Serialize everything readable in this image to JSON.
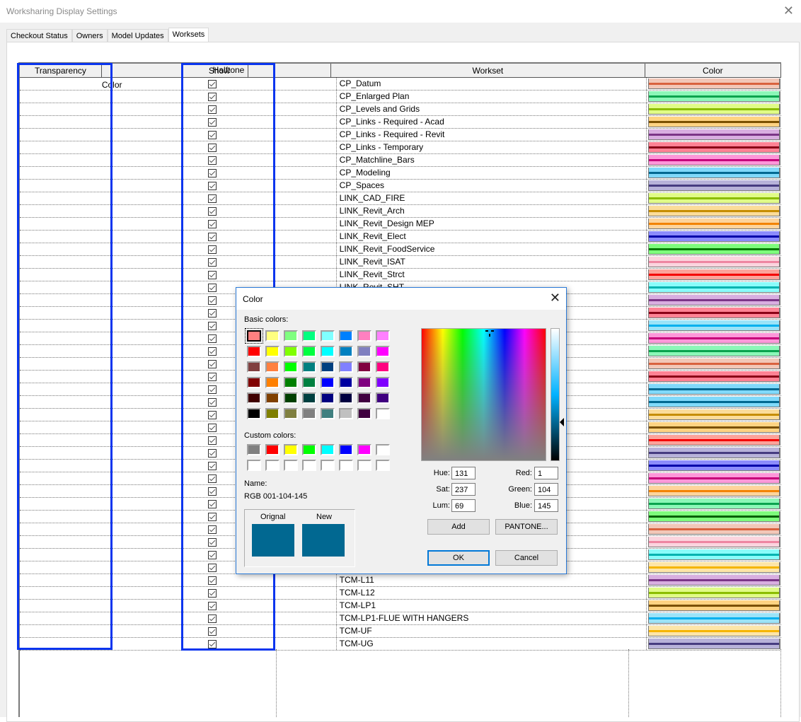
{
  "window": {
    "title": "Worksharing Display Settings",
    "close_glyph": "✕"
  },
  "tabs": [
    {
      "label": "Checkout Status",
      "active": false
    },
    {
      "label": "Owners",
      "active": false
    },
    {
      "label": "Model Updates",
      "active": false
    },
    {
      "label": "Worksets",
      "active": true
    }
  ],
  "table": {
    "headers": {
      "transparency": "Transparency",
      "show_color": "Show Color",
      "halftone": "Halftone",
      "workset": "Workset",
      "color": "Color"
    },
    "rows": [
      {
        "workset": "CP_Datum",
        "show_color": true,
        "fill": "#f2c7b8",
        "line": "#d9623f"
      },
      {
        "workset": "CP_Enlarged Plan",
        "show_color": true,
        "fill": "#8cf7b8",
        "line": "#0aa34e"
      },
      {
        "workset": "CP_Levels and Grids",
        "show_color": true,
        "fill": "#e0fb87",
        "line": "#8bbd00"
      },
      {
        "workset": "CP_Links - Required - Acad",
        "show_color": true,
        "fill": "#fed382",
        "line": "#7a5000"
      },
      {
        "workset": "CP_Links - Required - Revit",
        "show_color": true,
        "fill": "#d8aee0",
        "line": "#7b3587"
      },
      {
        "workset": "CP_Links - Temporary",
        "show_color": true,
        "fill": "#fe8294",
        "line": "#8a0016"
      },
      {
        "workset": "CP_Matchline_Bars",
        "show_color": true,
        "fill": "#fc97d9",
        "line": "#c6007b"
      },
      {
        "workset": "CP_Modeling",
        "show_color": true,
        "fill": "#80d9fa",
        "line": "#006891"
      },
      {
        "workset": "CP_Spaces",
        "show_color": true,
        "fill": "#b7b2d9",
        "line": "#463c80"
      },
      {
        "workset": "LINK_CAD_FIRE",
        "show_color": true,
        "fill": "#e0fb87",
        "line": "#8bbd00"
      },
      {
        "workset": "LINK_Revit_Arch",
        "show_color": true,
        "fill": "#fbdc9a",
        "line": "#c68d00"
      },
      {
        "workset": "LINK_Revit_Design MEP",
        "show_color": true,
        "fill": "#fdd49c",
        "line": "#f28300"
      },
      {
        "workset": "LINK_Revit_Elect",
        "show_color": true,
        "fill": "#8c8cfc",
        "line": "#0000aa"
      },
      {
        "workset": "LINK_Revit_FoodService",
        "show_color": true,
        "fill": "#7efc7c",
        "line": "#007a00"
      },
      {
        "workset": "LINK_Revit_ISAT",
        "show_color": true,
        "fill": "#fbd4de",
        "line": "#ee86a2"
      },
      {
        "workset": "LINK_Revit_Strct",
        "show_color": true,
        "fill": "#fca29a",
        "line": "#f40000"
      },
      {
        "workset": "LINK_Revit_SHT",
        "show_color": true,
        "fill": "#8afcfa",
        "line": "#00b3b0"
      },
      {
        "workset": "",
        "show_color": true,
        "fill": "#d8aee0",
        "line": "#7b3587"
      },
      {
        "workset": "",
        "show_color": true,
        "fill": "#fe8294",
        "line": "#8a0016"
      },
      {
        "workset": "",
        "show_color": true,
        "fill": "#9be3f8",
        "line": "#00b0ee"
      },
      {
        "workset": "",
        "show_color": true,
        "fill": "#fc97d9",
        "line": "#c6007b"
      },
      {
        "workset": "",
        "show_color": true,
        "fill": "#8cf7b8",
        "line": "#0aa34e"
      },
      {
        "workset": "",
        "show_color": true,
        "fill": "#f2c7b8",
        "line": "#d9623f"
      },
      {
        "workset": "",
        "show_color": true,
        "fill": "#fe8294",
        "line": "#8a0016"
      },
      {
        "workset": "",
        "show_color": true,
        "fill": "#80d9fa",
        "line": "#006891"
      },
      {
        "workset": "",
        "show_color": true,
        "fill": "#80d9fa",
        "line": "#006891"
      },
      {
        "workset": "",
        "show_color": true,
        "fill": "#fbdc9a",
        "line": "#c68d00"
      },
      {
        "workset": "",
        "show_color": true,
        "fill": "#fed382",
        "line": "#7a5000"
      },
      {
        "workset": "",
        "show_color": true,
        "fill": "#fca29a",
        "line": "#f40000"
      },
      {
        "workset": "",
        "show_color": true,
        "fill": "#b7b2d9",
        "line": "#463c80"
      },
      {
        "workset": "",
        "show_color": true,
        "fill": "#8c8cfc",
        "line": "#0000aa"
      },
      {
        "workset": "",
        "show_color": true,
        "fill": "#fc97d9",
        "line": "#c6007b"
      },
      {
        "workset": "",
        "show_color": true,
        "fill": "#fdd49c",
        "line": "#f28300"
      },
      {
        "workset": "",
        "show_color": true,
        "fill": "#8cf7b8",
        "line": "#0aa34e"
      },
      {
        "workset": "",
        "show_color": true,
        "fill": "#7efc7c",
        "line": "#006000"
      },
      {
        "workset": "",
        "show_color": true,
        "fill": "#f2c7b8",
        "line": "#d9623f"
      },
      {
        "workset": "",
        "show_color": true,
        "fill": "#fbd4de",
        "line": "#ee86a2"
      },
      {
        "workset": "",
        "show_color": true,
        "fill": "#8afcfa",
        "line": "#00b3b0"
      },
      {
        "workset": "",
        "show_color": true,
        "fill": "#fde5a8",
        "line": "#f5b500"
      },
      {
        "workset": "TCM-L11",
        "show_color": true,
        "fill": "#d8aee0",
        "line": "#7b3587"
      },
      {
        "workset": "TCM-L12",
        "show_color": true,
        "fill": "#e0fb87",
        "line": "#8bbd00"
      },
      {
        "workset": "TCM-LP1",
        "show_color": true,
        "fill": "#fed382",
        "line": "#7a5000"
      },
      {
        "workset": "TCM-LP1-FLUE WITH HANGERS",
        "show_color": true,
        "fill": "#9be3f8",
        "line": "#00b0ee"
      },
      {
        "workset": "TCM-UF",
        "show_color": true,
        "fill": "#fde5a8",
        "line": "#f5b500"
      },
      {
        "workset": "TCM-UG",
        "show_color": true,
        "fill": "#b7b2d9",
        "line": "#463c80"
      }
    ]
  },
  "highlight_color": "#0a35ef",
  "color_dialog": {
    "title": "Color",
    "close_glyph": "✕",
    "basic_colors_label": "Basic colors:",
    "basic_colors": [
      "#ff8080",
      "#ffff80",
      "#80ff80",
      "#00ff80",
      "#80ffff",
      "#0080ff",
      "#ff80c0",
      "#ff80ff",
      "#ff0000",
      "#ffff00",
      "#80ff00",
      "#00ff40",
      "#00ffff",
      "#0080c0",
      "#8080c0",
      "#ff00ff",
      "#804040",
      "#ff8040",
      "#00ff00",
      "#008080",
      "#004080",
      "#8080ff",
      "#800040",
      "#ff0080",
      "#800000",
      "#ff8000",
      "#008000",
      "#008040",
      "#0000ff",
      "#0000a0",
      "#800080",
      "#8000ff",
      "#400000",
      "#804000",
      "#004000",
      "#004040",
      "#000080",
      "#000040",
      "#400040",
      "#400080",
      "#000000",
      "#808000",
      "#808040",
      "#808080",
      "#408080",
      "#c0c0c0",
      "#400040",
      "#ffffff"
    ],
    "selected_basic_index": 0,
    "custom_colors_label": "Custom colors:",
    "custom_colors": [
      "#808080",
      "#ff0000",
      "#ffff00",
      "#00ff00",
      "#00ffff",
      "#0000ff",
      "#ff00ff",
      "#ffffff",
      "#ffffff",
      "#ffffff",
      "#ffffff",
      "#ffffff",
      "#ffffff",
      "#ffffff",
      "#ffffff",
      "#ffffff"
    ],
    "name_label": "Name:",
    "name_value": "RGB 001-104-145",
    "original_label": "Orignal",
    "new_label": "New",
    "original_color": "#016891",
    "new_color": "#016891",
    "hue_label": "Hue:",
    "hue": "131",
    "sat_label": "Sat:",
    "sat": "237",
    "lum_label": "Lum:",
    "lum": "69",
    "red_label": "Red:",
    "red": "1",
    "green_label": "Green:",
    "green": "104",
    "blue_label": "Blue:",
    "blue": "145",
    "add_label": "Add",
    "pantone_label": "PANTONE...",
    "ok_label": "OK",
    "cancel_label": "Cancel"
  }
}
